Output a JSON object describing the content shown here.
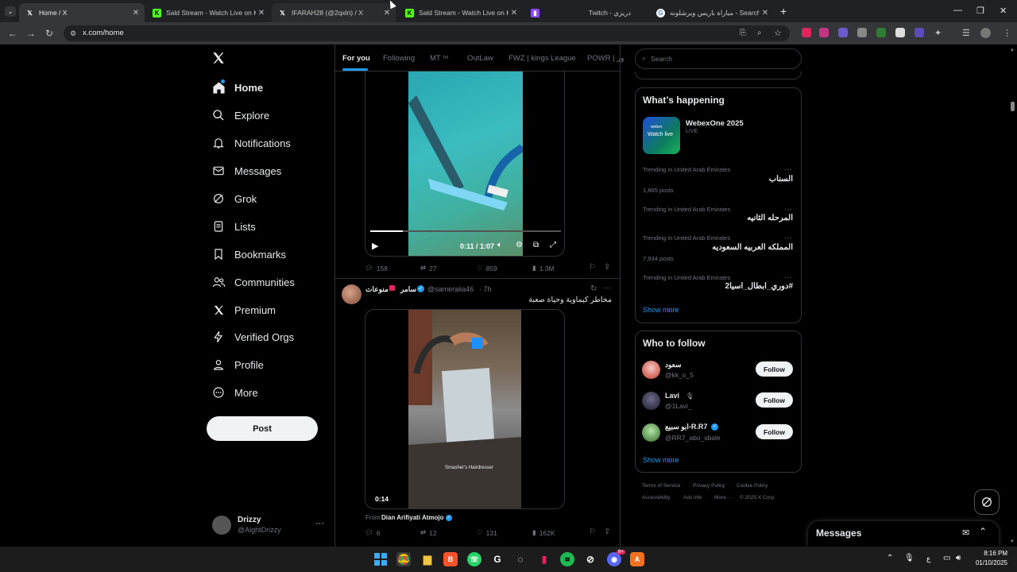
{
  "browser": {
    "tabs": [
      {
        "title": "Home / X",
        "favicon": "x-icon"
      },
      {
        "title": "Sald Stream - Watch Live on Ki",
        "favicon": "kick-icon"
      },
      {
        "title": "IFARAH28 (@2qxln) / X",
        "favicon": "x-icon"
      },
      {
        "title": "Sald Stream - Watch Live on Ki",
        "favicon": "kick-icon"
      },
      {
        "title": "Twitch - دريزي",
        "favicon": "twitch-icon"
      },
      {
        "title": "مباراة باريس ويرشلونه - Search",
        "favicon": "google-icon"
      }
    ],
    "new_tab": "+",
    "url": "x.com/home"
  },
  "sidebar": {
    "items": [
      {
        "label": "Home",
        "icon": "home-icon"
      },
      {
        "label": "Explore",
        "icon": "search-icon"
      },
      {
        "label": "Notifications",
        "icon": "bell-icon"
      },
      {
        "label": "Messages",
        "icon": "envelope-icon"
      },
      {
        "label": "Grok",
        "icon": "grok-icon"
      },
      {
        "label": "Lists",
        "icon": "list-icon"
      },
      {
        "label": "Bookmarks",
        "icon": "bookmark-icon"
      },
      {
        "label": "Communities",
        "icon": "people-icon"
      },
      {
        "label": "Premium",
        "icon": "x-icon"
      },
      {
        "label": "Verified Orgs",
        "icon": "lightning-icon"
      },
      {
        "label": "Profile",
        "icon": "person-icon"
      },
      {
        "label": "More",
        "icon": "more-circle-icon"
      }
    ],
    "post_button": "Post",
    "account": {
      "name": "Drizzy",
      "handle": "@AlghtDrizzy"
    }
  },
  "feed": {
    "tabs": [
      "For you",
      "Following",
      "MT",
      "OutLaw",
      "FWZ | kings League",
      "POWR | ور"
    ],
    "tab_badge": "TM",
    "video1": {
      "time": "0:11 / 1:07",
      "progress": 0.17
    },
    "stats1": {
      "replies": "158",
      "reposts": "27",
      "likes": "859",
      "views": "1.3M"
    },
    "post2": {
      "name": "سامر",
      "suffix": "منوعات",
      "handle": "@sameralia46",
      "time": "· 7h",
      "text": "مخاطر كيماوية وحياة صعبة",
      "video_time": "0:14",
      "watermark": "Smasher's Hairdresser",
      "from_label": "From",
      "from_name": "Dian Arifiyati Atmojo"
    },
    "stats2": {
      "replies": "6",
      "reposts": "12",
      "likes": "131",
      "views": "162K"
    }
  },
  "right": {
    "search_placeholder": "Search",
    "happening_title": "What’s happening",
    "event": {
      "title": "WebexOne 2025",
      "status": "LIVE",
      "thumb_text": "Watch live",
      "thumb_brand": "webex"
    },
    "trends": [
      {
        "context": "Trending in United Arab Emirates",
        "title": "السناب",
        "count": "1,865 posts"
      },
      {
        "context": "Trending in United Arab Emirates",
        "title": "المرحله الثانيه",
        "count": ""
      },
      {
        "context": "Trending in United Arab Emirates",
        "title": "المملكه العربيه السعوديه",
        "count": "7,934 posts"
      },
      {
        "context": "Trending in United Arab Emirates",
        "title": "#دوري_ابطال_اسيا2",
        "count": ""
      }
    ],
    "show_more": "Show more",
    "who_title": "Who to follow",
    "who": [
      {
        "name": "سعود",
        "handle": "@kk_o_5",
        "button": "Follow"
      },
      {
        "name": "Lavi",
        "handle": "@1Lavi_",
        "button": "Follow"
      },
      {
        "name": "ابو سبيع-R.R7",
        "handle": "@RR7_abo_sbale",
        "button": "Follow"
      }
    ],
    "show_more2": "Show more",
    "footer": [
      "Terms of Service",
      "Privacy Policy",
      "Cookie Policy",
      "Accessibility",
      "Ads info",
      "More ···",
      "© 2025 X Corp."
    ]
  },
  "messages_drawer": {
    "title": "Messages"
  },
  "taskbar": {
    "time": "8:16 PM",
    "date": "01/10/2025",
    "lang": "ع",
    "spotify_badge": "",
    "discord_badge": "9+"
  },
  "colors": {
    "accent": "#1d9bf0",
    "bg": "#000000",
    "border": "#2f3336"
  }
}
